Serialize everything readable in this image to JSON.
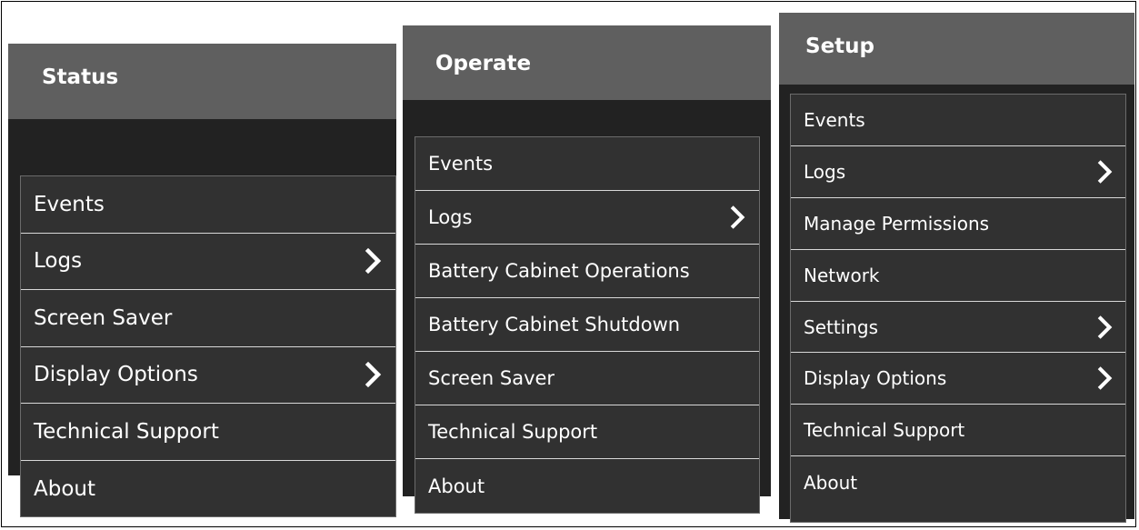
{
  "menus": [
    {
      "id": "status",
      "title": "Status",
      "items": [
        {
          "label": "Events",
          "has_submenu": false
        },
        {
          "label": "Logs",
          "has_submenu": true
        },
        {
          "label": "Screen Saver",
          "has_submenu": false
        },
        {
          "label": "Display Options",
          "has_submenu": true
        },
        {
          "label": "Technical Support",
          "has_submenu": false
        },
        {
          "label": "About",
          "has_submenu": false
        }
      ]
    },
    {
      "id": "operate",
      "title": "Operate",
      "items": [
        {
          "label": "Events",
          "has_submenu": false
        },
        {
          "label": "Logs",
          "has_submenu": true
        },
        {
          "label": "Battery Cabinet Operations",
          "has_submenu": false
        },
        {
          "label": "Battery Cabinet Shutdown",
          "has_submenu": false
        },
        {
          "label": "Screen Saver",
          "has_submenu": false
        },
        {
          "label": "Technical Support",
          "has_submenu": false
        },
        {
          "label": "About",
          "has_submenu": false
        }
      ]
    },
    {
      "id": "setup",
      "title": "Setup",
      "items": [
        {
          "label": "Events",
          "has_submenu": false
        },
        {
          "label": "Logs",
          "has_submenu": true
        },
        {
          "label": "Manage Permissions",
          "has_submenu": false
        },
        {
          "label": "Network",
          "has_submenu": false
        },
        {
          "label": "Settings",
          "has_submenu": true
        },
        {
          "label": "Display Options",
          "has_submenu": true
        },
        {
          "label": "Technical Support",
          "has_submenu": false
        },
        {
          "label": "About",
          "has_submenu": false
        }
      ]
    }
  ],
  "icons": {
    "submenu": "chevron-right-icon"
  },
  "colors": {
    "panel_bg": "#222222",
    "header_bg": "#5f5f5f",
    "list_bg": "#313131",
    "divider": "#d8d8d8",
    "text": "#ffffff"
  }
}
